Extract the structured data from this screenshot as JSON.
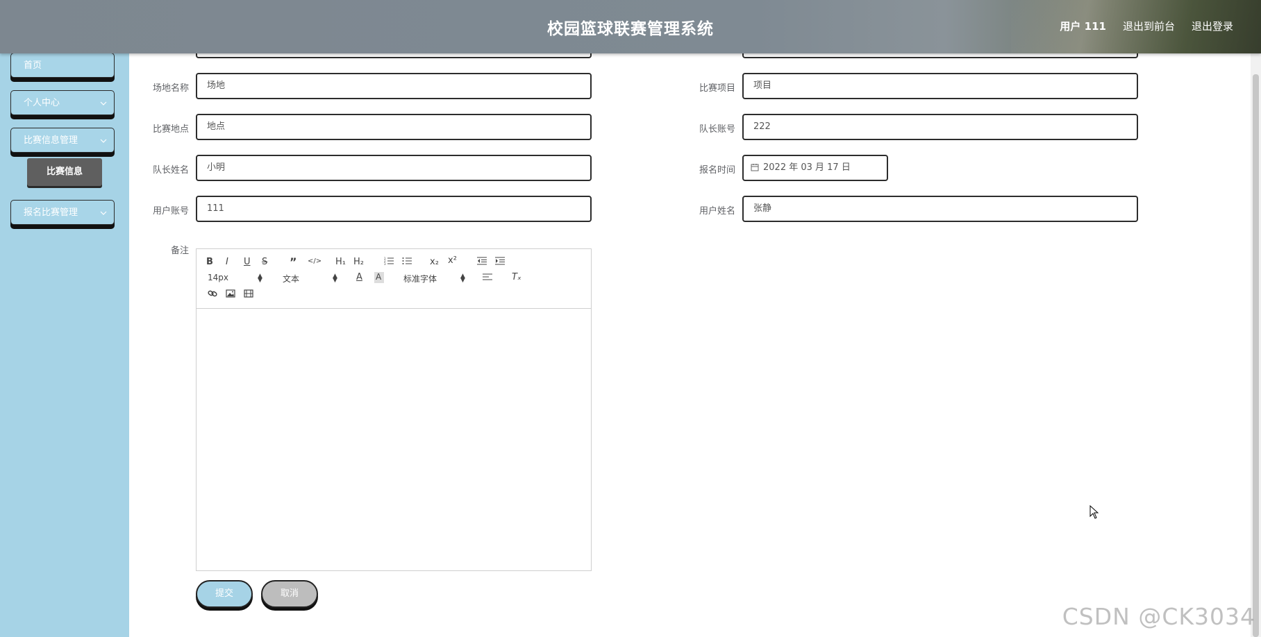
{
  "header": {
    "title": "校园篮球联赛管理系统",
    "user": "用户 111",
    "to_front": "退出到前台",
    "logout": "退出登录"
  },
  "sidebar": {
    "items": [
      {
        "label": "首页"
      },
      {
        "label": "个人中心"
      },
      {
        "label": "比赛信息管理"
      },
      {
        "label": "报名比赛管理"
      }
    ],
    "sub_item": "比赛信息"
  },
  "form": {
    "venue_label": "场地名称",
    "venue_value": "场地",
    "event_label": "比赛项目",
    "event_value": "项目",
    "location_label": "比赛地点",
    "location_value": "地点",
    "captain_account_label": "队长账号",
    "captain_account_value": "222",
    "captain_name_label": "队长姓名",
    "captain_name_value": "小明",
    "signup_time_label": "报名时间",
    "signup_time_value": "2022 年 03 月 17 日",
    "user_account_label": "用户账号",
    "user_account_value": "111",
    "user_name_label": "用户姓名",
    "user_name_value": "张静",
    "remark_label": "备注"
  },
  "editor": {
    "bold": "B",
    "italic": "I",
    "underline": "U",
    "strike": "S",
    "quote": "”",
    "code": "</>",
    "h1": "H₁",
    "h2": "H₂",
    "sub": "x₂",
    "sup": "x²",
    "font_size": "14px",
    "text_style": "文本",
    "font_family": "标准字体",
    "color_a": "A",
    "clear": "Tₓ"
  },
  "actions": {
    "submit": "提交",
    "cancel": "取消"
  },
  "watermark": "CSDN @CK3034",
  "colors": {
    "sidebar": "#a6d3e6",
    "header": "#7f8a93",
    "submit": "#a6d3e6",
    "cancel": "#bdbdbd"
  }
}
